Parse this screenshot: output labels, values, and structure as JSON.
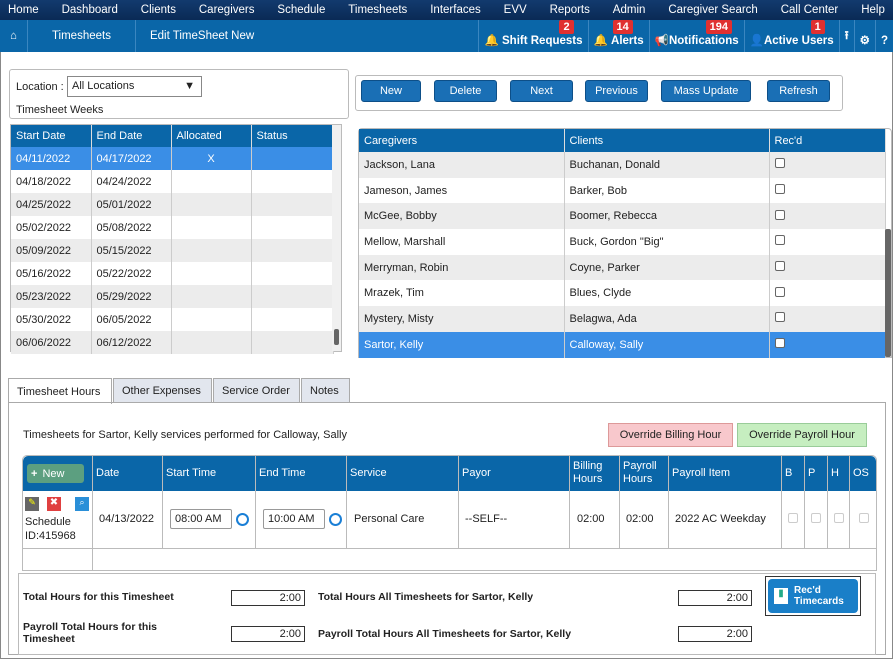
{
  "topnav": [
    "Home",
    "Dashboard",
    "Clients",
    "Caregivers",
    "Schedule",
    "Timesheets",
    "Interfaces",
    "EVV",
    "Reports",
    "Admin",
    "Caregiver Search",
    "Call Center",
    "Help"
  ],
  "breadcrumb": {
    "items": [
      "Timesheets",
      "Edit TimeSheet New"
    ]
  },
  "rightnav": {
    "shift_requests": "Shift Requests",
    "shift_requests_count": "2",
    "alerts": "Alerts",
    "alerts_count": "14",
    "notifications": "Notifications",
    "notifications_count": "194",
    "active_users": "Active Users",
    "active_users_count": "1"
  },
  "location": {
    "label": "Location :",
    "value": "All Locations",
    "weeks_label": "Timesheet Weeks"
  },
  "weeks": {
    "headers": [
      "Start Date",
      "End Date",
      "Allocated",
      "Status"
    ],
    "rows": [
      [
        "04/11/2022",
        "04/17/2022",
        "X",
        ""
      ],
      [
        "04/18/2022",
        "04/24/2022",
        "",
        ""
      ],
      [
        "04/25/2022",
        "05/01/2022",
        "",
        ""
      ],
      [
        "05/02/2022",
        "05/08/2022",
        "",
        ""
      ],
      [
        "05/09/2022",
        "05/15/2022",
        "",
        ""
      ],
      [
        "05/16/2022",
        "05/22/2022",
        "",
        ""
      ],
      [
        "05/23/2022",
        "05/29/2022",
        "",
        ""
      ],
      [
        "05/30/2022",
        "06/05/2022",
        "",
        ""
      ],
      [
        "06/06/2022",
        "06/12/2022",
        "",
        ""
      ]
    ]
  },
  "buttons": {
    "new": "New",
    "delete": "Delete",
    "next": "Next",
    "previous": "Previous",
    "mass_update": "Mass Update",
    "refresh": "Refresh"
  },
  "pairs": {
    "headers": [
      "Caregivers",
      "Clients",
      "Rec'd"
    ],
    "rows": [
      [
        "Jackson, Lana",
        "Buchanan, Donald"
      ],
      [
        "Jameson, James",
        "Barker, Bob"
      ],
      [
        "McGee, Bobby",
        "Boomer, Rebecca"
      ],
      [
        "Mellow, Marshall",
        "Buck, Gordon \"Big\""
      ],
      [
        "Merryman, Robin",
        "Coyne, Parker"
      ],
      [
        "Mrazek, Tim",
        "Blues, Clyde"
      ],
      [
        "Mystery, Misty",
        "Belagwa, Ada"
      ],
      [
        "Sartor, Kelly",
        "Calloway, Sally"
      ]
    ]
  },
  "tabs": [
    "Timesheet Hours",
    "Other Expenses",
    "Service Order",
    "Notes"
  ],
  "hours": {
    "title": "Timesheets for Sartor, Kelly services performed for Calloway, Sally",
    "override_billing": "Override Billing Hour",
    "override_payroll": "Override Payroll Hour",
    "new_label": "New",
    "headers": [
      "Date",
      "Start Time",
      "End Time",
      "Service",
      "Payor",
      "Billing Hours",
      "Payroll Hours",
      "Payroll Item",
      "B",
      "P",
      "H",
      "OS"
    ],
    "row": {
      "schedule": "Schedule ID:415968",
      "date": "04/13/2022",
      "start": "08:00 AM",
      "end": "10:00 AM",
      "service": "Personal Care",
      "payor": "--SELF--",
      "billing": "02:00",
      "payroll": "02:00",
      "item": "2022 AC Weekday"
    }
  },
  "totals": {
    "total_label": "Total Hours for this Timesheet",
    "total_value": "2:00",
    "all_label": "Total Hours All Timesheets for Sartor, Kelly",
    "all_value": "2:00",
    "payroll_label": "Payroll Total Hours for this Timesheet",
    "payroll_value": "2:00",
    "payroll_all_label": "Payroll Total Hours All Timesheets for Sartor, Kelly",
    "payroll_all_value": "2:00",
    "recd_button": "Rec'd Timecards"
  }
}
